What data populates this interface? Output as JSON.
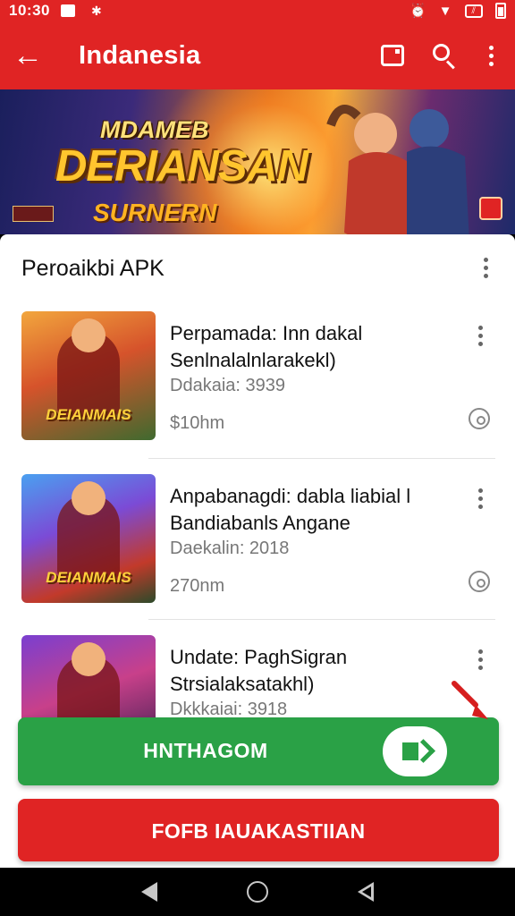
{
  "status_bar": {
    "time": "10:30",
    "icons": [
      "notification-icon",
      "bluetooth-icon",
      "alarm-icon",
      "wifi-icon",
      "signal-icon",
      "battery-icon"
    ]
  },
  "app_bar": {
    "title": "Indanesia",
    "icons": [
      "back-arrow-icon",
      "tablet-icon",
      "search-icon",
      "more-vert-icon"
    ]
  },
  "banner": {
    "logo_top": "MDAMEB",
    "logo_main": "DERIANSAN",
    "logo_sub": "SURNERN"
  },
  "section": {
    "header": "Peroaikbi APK"
  },
  "items": [
    {
      "thumb_text": "DEIANMAIS",
      "name_line1": "Perpamada: Inn dakal",
      "name_line2": "Senlnalalnlarakekl)",
      "meta": "Ddakaia: 3939",
      "size": "$10hm"
    },
    {
      "thumb_text": "DEIANMAIS",
      "name_line1": "Anpabanagdi: dabla liabial l",
      "name_line2": "Bandiabanls Angane",
      "meta": "Daekalin: 2018",
      "size": "270nm"
    },
    {
      "thumb_text": "",
      "name_line1": "Undate: PaghSigran",
      "name_line2": "Strsialaksatakhl)",
      "meta": "Dkkkaiai: 3918",
      "size": ""
    }
  ],
  "buttons": {
    "primary_label": "HNTHAGOM",
    "secondary_label": "FOFB IAUAKASTIIAN"
  },
  "colors": {
    "brand_red": "#e02424",
    "action_green": "#2aa146"
  }
}
